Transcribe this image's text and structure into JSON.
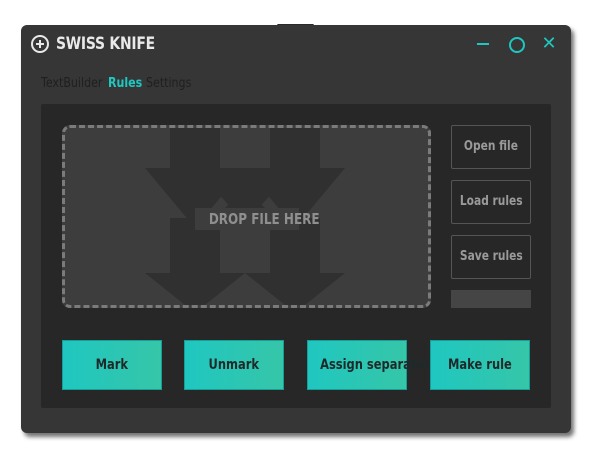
{
  "app": {
    "title": "SWISS KNIFE"
  },
  "window_controls": {
    "minimize_icon": "minimize-icon",
    "maximize_icon": "circle-icon",
    "close_glyph": "✕"
  },
  "tabs": [
    {
      "label": "TextBuilder",
      "active": false
    },
    {
      "label": "Rules",
      "active": true
    },
    {
      "label": "Settings",
      "active": false
    }
  ],
  "dropzone": {
    "label": "DROP FILE HERE",
    "icon": "down-arrows-icon"
  },
  "side_buttons": {
    "open": "Open file",
    "load": "Load rules",
    "save": "Save rules"
  },
  "actions": {
    "mark": "Mark",
    "unmark": "Unmark",
    "assign": "Assign separator",
    "make_rule": "Make rule"
  },
  "colors": {
    "accent": "#1ec8c0",
    "window": "#363636",
    "panel": "#272727"
  }
}
